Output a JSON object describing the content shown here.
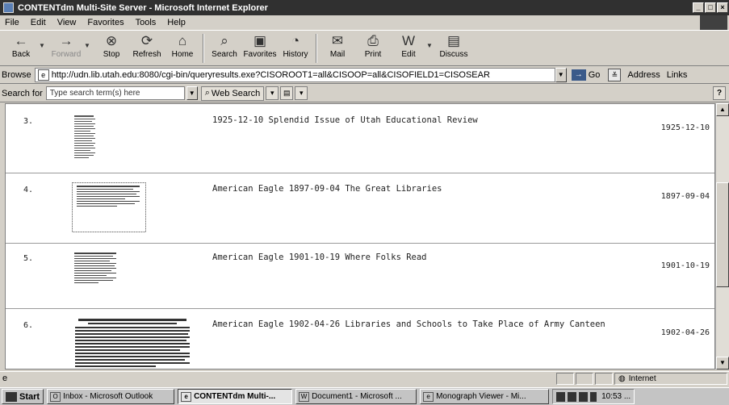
{
  "window": {
    "title": "CONTENTdm Multi-Site Server - Microsoft Internet Explorer",
    "controls": [
      "_",
      "□",
      "×"
    ]
  },
  "menu": [
    "File",
    "Edit",
    "View",
    "Favorites",
    "Tools",
    "Help"
  ],
  "toolbar": [
    {
      "id": "back",
      "label": "Back",
      "icon": "←",
      "dropdown": true,
      "disabled": false
    },
    {
      "id": "forward",
      "label": "Forward",
      "icon": "→",
      "dropdown": true,
      "disabled": true
    },
    {
      "id": "stop",
      "label": "Stop",
      "icon": "⊗",
      "dropdown": false,
      "disabled": false
    },
    {
      "id": "refresh",
      "label": "Refresh",
      "icon": "⟳",
      "dropdown": false,
      "disabled": false
    },
    {
      "id": "home",
      "label": "Home",
      "icon": "⌂",
      "dropdown": false,
      "disabled": false
    },
    {
      "id": "search",
      "label": "Search",
      "icon": "⌕",
      "dropdown": false,
      "disabled": false
    },
    {
      "id": "favorites",
      "label": "Favorites",
      "icon": "▣",
      "dropdown": false,
      "disabled": false
    },
    {
      "id": "history",
      "label": "History",
      "icon": "◔",
      "dropdown": false,
      "disabled": false
    },
    {
      "id": "mail",
      "label": "Mail",
      "icon": "✉",
      "dropdown": true,
      "disabled": false
    },
    {
      "id": "print",
      "label": "Print",
      "icon": "⎙",
      "dropdown": false,
      "disabled": false
    },
    {
      "id": "edit",
      "label": "Edit",
      "icon": "W",
      "dropdown": true,
      "disabled": false
    },
    {
      "id": "discuss",
      "label": "Discuss",
      "icon": "▤",
      "dropdown": false,
      "disabled": false
    }
  ],
  "address_bar": {
    "label": "Browse",
    "url": "http://udn.lib.utah.edu:8080/cgi-bin/queryresults.exe?CISOROOT1=all&CISOOP=all&CISOFIELD1=CISOSEAR",
    "go_label": "Go",
    "address_label": "Address",
    "links_label": "Links"
  },
  "search_bar": {
    "label": "Search for",
    "placeholder": "Type search term(s) here",
    "web_search_label": "Web Search",
    "help_label": "?"
  },
  "results": [
    {
      "num": "3.",
      "title": "1925-12-10 Splendid Issue of Utah Educational Review",
      "date": "1925-12-10"
    },
    {
      "num": "4.",
      "title": "American Eagle 1897-09-04 The Great Libraries",
      "date": "1897-09-04"
    },
    {
      "num": "5.",
      "title": "American Eagle 1901-10-19 Where Folks Read",
      "date": "1901-10-19"
    },
    {
      "num": "6.",
      "title": "American Eagle 1902-04-26 Libraries and Schools to Take Place of Army Canteen",
      "date": "1902-04-26"
    }
  ],
  "status_bar": {
    "zone": "Internet"
  },
  "taskbar": {
    "start": "Start",
    "tasks": [
      {
        "label": "Inbox - Microsoft Outlook",
        "active": false
      },
      {
        "label": "CONTENTdm Multi-...",
        "active": true
      },
      {
        "label": "Document1 - Microsoft ...",
        "active": false
      },
      {
        "label": "Monograph Viewer - Mi...",
        "active": false
      }
    ],
    "clock": "10:53 ..."
  }
}
